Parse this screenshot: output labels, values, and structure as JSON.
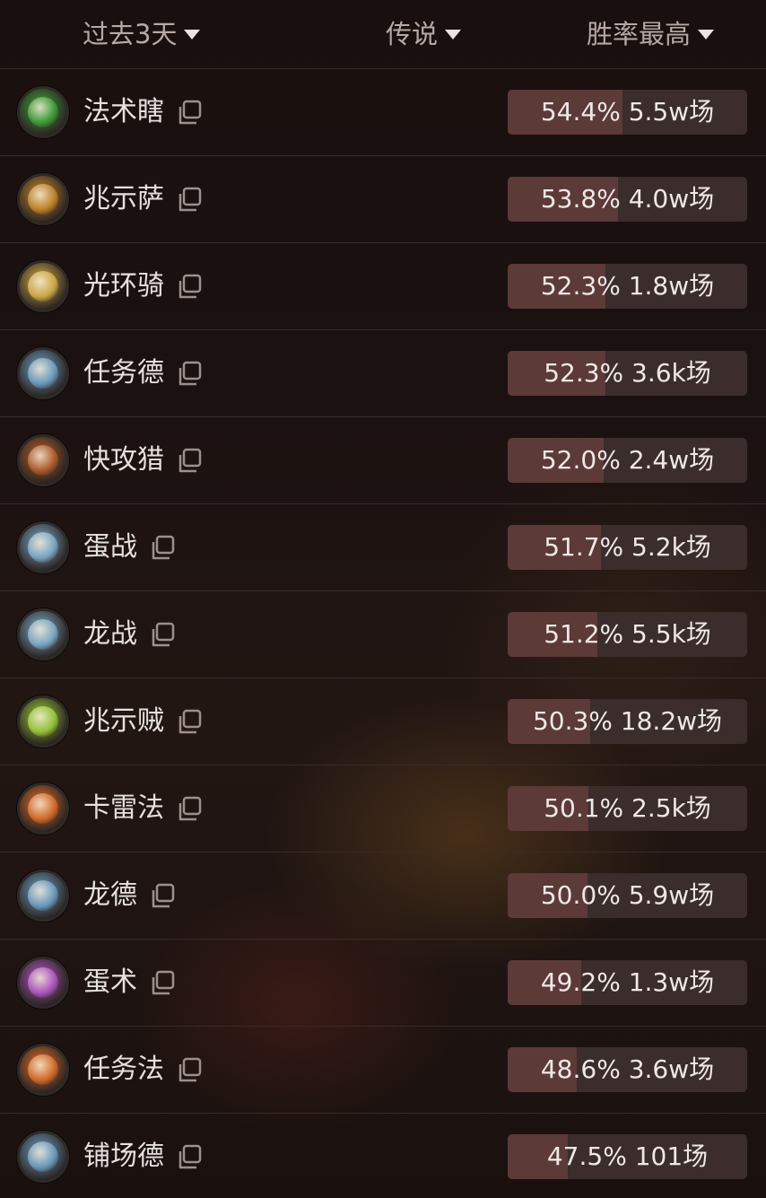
{
  "filters": {
    "time": "过去3天",
    "rank": "传说",
    "sort": "胜率最高"
  },
  "decks": [
    {
      "name": "法术瞎",
      "icon": "demon-hunter-class-icon",
      "accent": "#3fa33a",
      "winrate": "54.4%",
      "games": "5.5w场",
      "winrate_value": 54.4
    },
    {
      "name": "兆示萨",
      "icon": "shaman-class-icon",
      "accent": "#c88a2c",
      "winrate": "53.8%",
      "games": "4.0w场",
      "winrate_value": 53.8
    },
    {
      "name": "光环骑",
      "icon": "paladin-class-icon",
      "accent": "#d8b24a",
      "winrate": "52.3%",
      "games": "1.8w场",
      "winrate_value": 52.3
    },
    {
      "name": "任务德",
      "icon": "druid-class-icon",
      "accent": "#6fa3c9",
      "winrate": "52.3%",
      "games": "3.6k场",
      "winrate_value": 52.3
    },
    {
      "name": "快攻猎",
      "icon": "hunter-class-icon",
      "accent": "#b5602c",
      "winrate": "52.0%",
      "games": "2.4w场",
      "winrate_value": 52.0
    },
    {
      "name": "蛋战",
      "icon": "warrior-class-icon",
      "accent": "#7fb0d0",
      "winrate": "51.7%",
      "games": "5.2k场",
      "winrate_value": 51.7
    },
    {
      "name": "龙战",
      "icon": "warrior-class-icon",
      "accent": "#7fb0d0",
      "winrate": "51.2%",
      "games": "5.5k场",
      "winrate_value": 51.2
    },
    {
      "name": "兆示贼",
      "icon": "rogue-class-icon",
      "accent": "#9ccf3a",
      "winrate": "50.3%",
      "games": "18.2w场",
      "winrate_value": 50.3
    },
    {
      "name": "卡雷法",
      "icon": "mage-class-icon",
      "accent": "#e0702a",
      "winrate": "50.1%",
      "games": "2.5k场",
      "winrate_value": 50.1
    },
    {
      "name": "龙德",
      "icon": "druid-class-icon",
      "accent": "#6fa3c9",
      "winrate": "50.0%",
      "games": "5.9w场",
      "winrate_value": 50.0
    },
    {
      "name": "蛋术",
      "icon": "warlock-class-icon",
      "accent": "#b45ac8",
      "winrate": "49.2%",
      "games": "1.3w场",
      "winrate_value": 49.2
    },
    {
      "name": "任务法",
      "icon": "mage-class-icon",
      "accent": "#e0702a",
      "winrate": "48.6%",
      "games": "3.6w场",
      "winrate_value": 48.6
    },
    {
      "name": "铺场德",
      "icon": "druid-class-icon",
      "accent": "#6fa3c9",
      "winrate": "47.5%",
      "games": "101场",
      "winrate_value": 47.5
    }
  ]
}
